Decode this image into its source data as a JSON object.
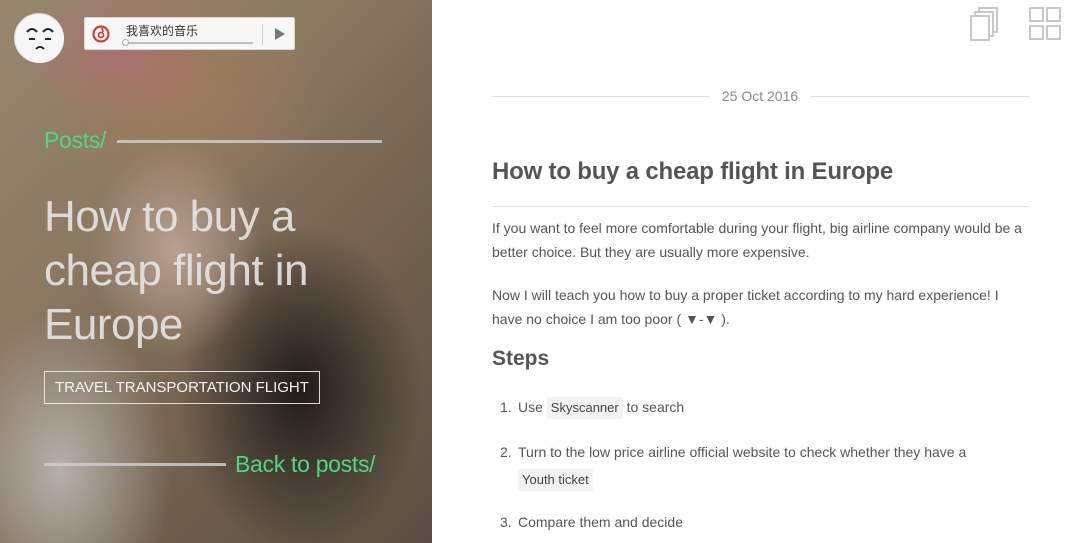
{
  "player": {
    "song_title": "我喜欢的音乐",
    "progress": 0.0
  },
  "hero": {
    "posts_link": "Posts/",
    "title": "How to buy a cheap flight in Europe",
    "tags": "TRAVEL TRANSPORTATION FLIGHT",
    "back_link": "Back to posts/"
  },
  "article": {
    "date": "25 Oct 2016",
    "title": "How to buy a cheap flight in Europe",
    "paragraphs": [
      "If you want to feel more comfortable during your flight, big airline company would be a better choice. But they are usually more expensive.",
      "Now I will teach you how to buy a proper ticket according to my hard experience! I have no choice I am too poor ( ▼-▼ )."
    ],
    "steps_heading": "Steps",
    "steps": [
      {
        "num": "1.",
        "before": "Use",
        "code": "Skyscanner",
        "after": "to search"
      },
      {
        "num": "2.",
        "before": "Turn to the low price airline official website to check whether they have a",
        "code": "Youth ticket"
      },
      {
        "num": "3.",
        "before": "Compare them and decide"
      }
    ]
  },
  "colors": {
    "accent_green": "#4fd880",
    "text": "#555555",
    "netease_red": "#d43c33"
  },
  "icons": {
    "pages": "pages-icon",
    "grid": "grid-icon",
    "music_logo": "netease-music-icon",
    "play": "play-icon"
  }
}
